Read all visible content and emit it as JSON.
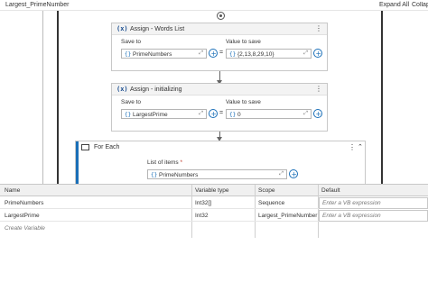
{
  "workflow": {
    "title": "Largest_PrimeNumber",
    "expand_all": "Expand All",
    "collapse_all": "Collapse All"
  },
  "activities": [
    {
      "icon": "(x)",
      "title": "Assign - Words List",
      "save_to_label": "Save to",
      "save_to_value": "PrimeNumbers",
      "value_label": "Value to save",
      "value": "{2,13,8,29,10}"
    },
    {
      "icon": "(x)",
      "title": "Assign - initializing",
      "save_to_label": "Save to",
      "save_to_value": "LargestPrime",
      "value_label": "Value to save",
      "value": "0"
    }
  ],
  "foreach": {
    "title": "For Each",
    "list_label": "List of items",
    "required_mark": "*",
    "list_value": "PrimeNumbers"
  },
  "variables": {
    "columns": [
      "Name",
      "Variable type",
      "Scope",
      "Default"
    ],
    "rows": [
      {
        "name": "PrimeNumbers",
        "type": "Int32[]",
        "scope": "Sequence",
        "default": "Enter a VB expression"
      },
      {
        "name": "LargestPrime",
        "type": "Int32",
        "scope": "Largest_PrimeNumber",
        "default": "Enter a VB expression"
      }
    ],
    "create_label": "Create Variable"
  }
}
